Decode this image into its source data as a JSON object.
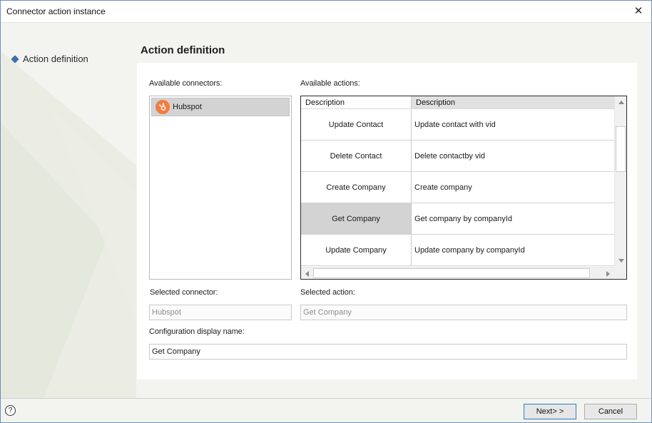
{
  "window": {
    "title": "Connector action instance",
    "close_label": "✕"
  },
  "sidebar": {
    "steps": [
      {
        "label": "Action definition"
      }
    ]
  },
  "main": {
    "title": "Action definition",
    "available_connectors_label": "Available connectors:",
    "available_actions_label": "Available actions:",
    "connectors": [
      {
        "name": "Hubspot",
        "icon": "hubspot-logo-icon"
      }
    ],
    "actions_columns": [
      "Description",
      "Description"
    ],
    "actions": [
      {
        "name": "Update Contact",
        "description": "Update contact with vid"
      },
      {
        "name": "Delete Contact",
        "description": "Delete contactby vid"
      },
      {
        "name": "Create Company",
        "description": "Create company"
      },
      {
        "name": "Get Company",
        "description": "Get company by companyId"
      },
      {
        "name": "Update Company",
        "description": "Update company by companyId"
      }
    ],
    "selected_action_index": 3,
    "selected_connector_label": "Selected connector:",
    "selected_connector_value": "Hubspot",
    "selected_action_label": "Selected action:",
    "selected_action_value": "Get Company",
    "config_name_label": "Configuration display name:",
    "config_name_value": "Get Company"
  },
  "footer": {
    "help_label": "?",
    "next_label": "Next> >",
    "cancel_label": "Cancel"
  },
  "colors": {
    "accent": "#3b6fb1",
    "hubspot": "#f37c40",
    "selected_row": "#d3d3d3"
  }
}
